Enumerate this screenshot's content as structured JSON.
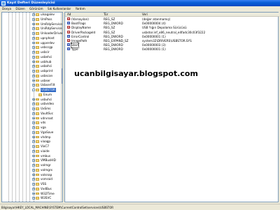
{
  "window": {
    "title": "Kayıt Defteri Düzenleyicisi"
  },
  "menu": [
    "Dosya",
    "Düzen",
    "Görünüm",
    "Sık Kullanılanlar",
    "Yardım"
  ],
  "tree": {
    "items": [
      {
        "label": "ulsagalev",
        "expand": "+"
      },
      {
        "label": "UmPass",
        "expand": "+"
      },
      {
        "label": "UmRdpService",
        "expand": "+"
      },
      {
        "label": "UniRdpService",
        "expand": "+"
      },
      {
        "label": "UnloaderDriver",
        "expand": "+"
      },
      {
        "label": "upnphost",
        "expand": "+"
      },
      {
        "label": "upperdev",
        "expand": "+"
      },
      {
        "label": "usbccgp",
        "expand": "+"
      },
      {
        "label": "usbcir",
        "expand": "+"
      },
      {
        "label": "usbehci",
        "expand": "+"
      },
      {
        "label": "usbhub",
        "expand": "+"
      },
      {
        "label": "usbohci",
        "expand": "+"
      },
      {
        "label": "usbprint",
        "expand": "+"
      },
      {
        "label": "usbscan",
        "expand": "+"
      },
      {
        "label": "usbser",
        "expand": "+"
      },
      {
        "label": "UsbserFilt",
        "expand": "+"
      },
      {
        "label": "USBSTOR",
        "expand": "-",
        "selected": true
      },
      {
        "label": "Enum",
        "expand": "",
        "sub": true
      },
      {
        "label": "usbuhci",
        "expand": "+"
      },
      {
        "label": "usbvideo",
        "expand": "+"
      },
      {
        "label": "UxSms",
        "expand": "+"
      },
      {
        "label": "VaultSvc",
        "expand": "+"
      },
      {
        "label": "vdrvroot",
        "expand": "+"
      },
      {
        "label": "vds",
        "expand": "+"
      },
      {
        "label": "vga",
        "expand": "+"
      },
      {
        "label": "VgaSave",
        "expand": "+"
      },
      {
        "label": "vhdmp",
        "expand": "+"
      },
      {
        "label": "viaagp",
        "expand": "+"
      },
      {
        "label": "ViaC7",
        "expand": "+"
      },
      {
        "label": "viaide",
        "expand": "+"
      },
      {
        "label": "vmbus",
        "expand": "+"
      },
      {
        "label": "VMBusHID",
        "expand": "+"
      },
      {
        "label": "volmgr",
        "expand": "+"
      },
      {
        "label": "volmgrx",
        "expand": "+"
      },
      {
        "label": "volsnap",
        "expand": "+"
      },
      {
        "label": "vsmraid",
        "expand": "+"
      },
      {
        "label": "VSS",
        "expand": "+"
      },
      {
        "label": "VxdBus",
        "expand": "+"
      },
      {
        "label": "W32Time",
        "expand": "+"
      },
      {
        "label": "W3SVC",
        "expand": "+"
      }
    ]
  },
  "values": {
    "columns": {
      "name": "Ad",
      "type": "Tür",
      "data": "Veri"
    },
    "rows": [
      {
        "icon": "sz",
        "name": "(Varsayılan)",
        "type": "REG_SZ",
        "data": "(değer atanmamış)"
      },
      {
        "icon": "dw",
        "name": "BootFlags",
        "type": "REG_DWORD",
        "data": "0x00000004 (4)"
      },
      {
        "icon": "sz",
        "name": "DisplayName",
        "type": "REG_SZ",
        "data": "USB Yığın Depolama Sürücüsü"
      },
      {
        "icon": "sz",
        "name": "DriverPackageId",
        "type": "REG_SZ",
        "data": "usbstor.inf_x86_neutral_e4fadc30c03f3222"
      },
      {
        "icon": "dw",
        "name": "ErrorControl",
        "type": "REG_DWORD",
        "data": "0x00000001 (1)"
      },
      {
        "icon": "sz",
        "name": "ImagePath",
        "type": "REG_EXPAND_SZ",
        "data": "system32\\DRIVERS\\USBSTOR.SYS"
      },
      {
        "icon": "dw",
        "name": "Start",
        "type": "REG_DWORD",
        "data": "0x00000003 (3)",
        "focus": true
      },
      {
        "icon": "dw",
        "name": "Type",
        "type": "REG_DWORD",
        "data": "0x00000001 (1)"
      }
    ]
  },
  "watermark": "ucanbilgisayar.blogspot.com",
  "statusbar": "Bilgisayar\\HKEY_LOCAL_MACHINE\\SYSTEM\\CurrentControlSet\\services\\USBSTOR"
}
